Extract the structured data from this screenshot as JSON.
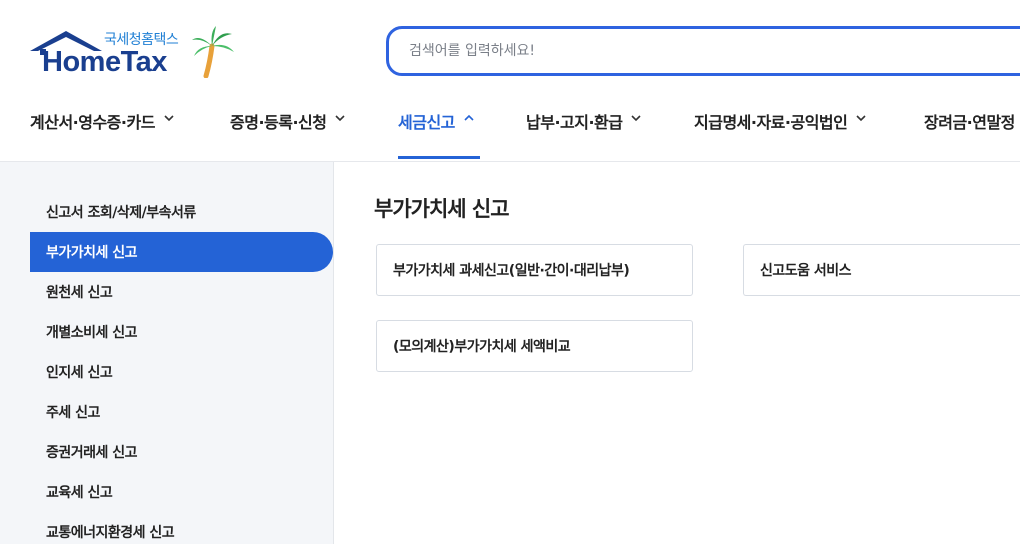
{
  "logo": {
    "subtitle": "국세청홈택스",
    "name": "HomeTax"
  },
  "search": {
    "placeholder": "검색어를 입력하세요!"
  },
  "nav": {
    "items": [
      {
        "label": "계산서·영수증·카드"
      },
      {
        "label": "증명·등록·신청"
      },
      {
        "label": "세금신고"
      },
      {
        "label": "납부·고지·환급"
      },
      {
        "label": "지급명세·자료·공익법인"
      },
      {
        "label": "장려금·연말정"
      }
    ],
    "active_index": 2
  },
  "sidebar": {
    "items": [
      {
        "label": "신고서 조회/삭제/부속서류"
      },
      {
        "label": "부가가치세 신고"
      },
      {
        "label": "원천세 신고"
      },
      {
        "label": "개별소비세 신고"
      },
      {
        "label": "인지세 신고"
      },
      {
        "label": "주세 신고"
      },
      {
        "label": "증권거래세 신고"
      },
      {
        "label": "교육세 신고"
      },
      {
        "label": "교통에너지환경세 신고"
      }
    ],
    "active_index": 1
  },
  "main": {
    "title": "부가가치세 신고",
    "cards": [
      {
        "label": "부가가치세 과세신고(일반·간이·대리납부)"
      },
      {
        "label": "신고도움 서비스"
      },
      {
        "label": "(모의계산)부가가치세 세액비교"
      }
    ]
  },
  "colors": {
    "accent": "#2463d6",
    "search_border": "#2f63e0",
    "logo_navy": "#1a3f8f",
    "logo_sub": "#1f7fd4"
  }
}
